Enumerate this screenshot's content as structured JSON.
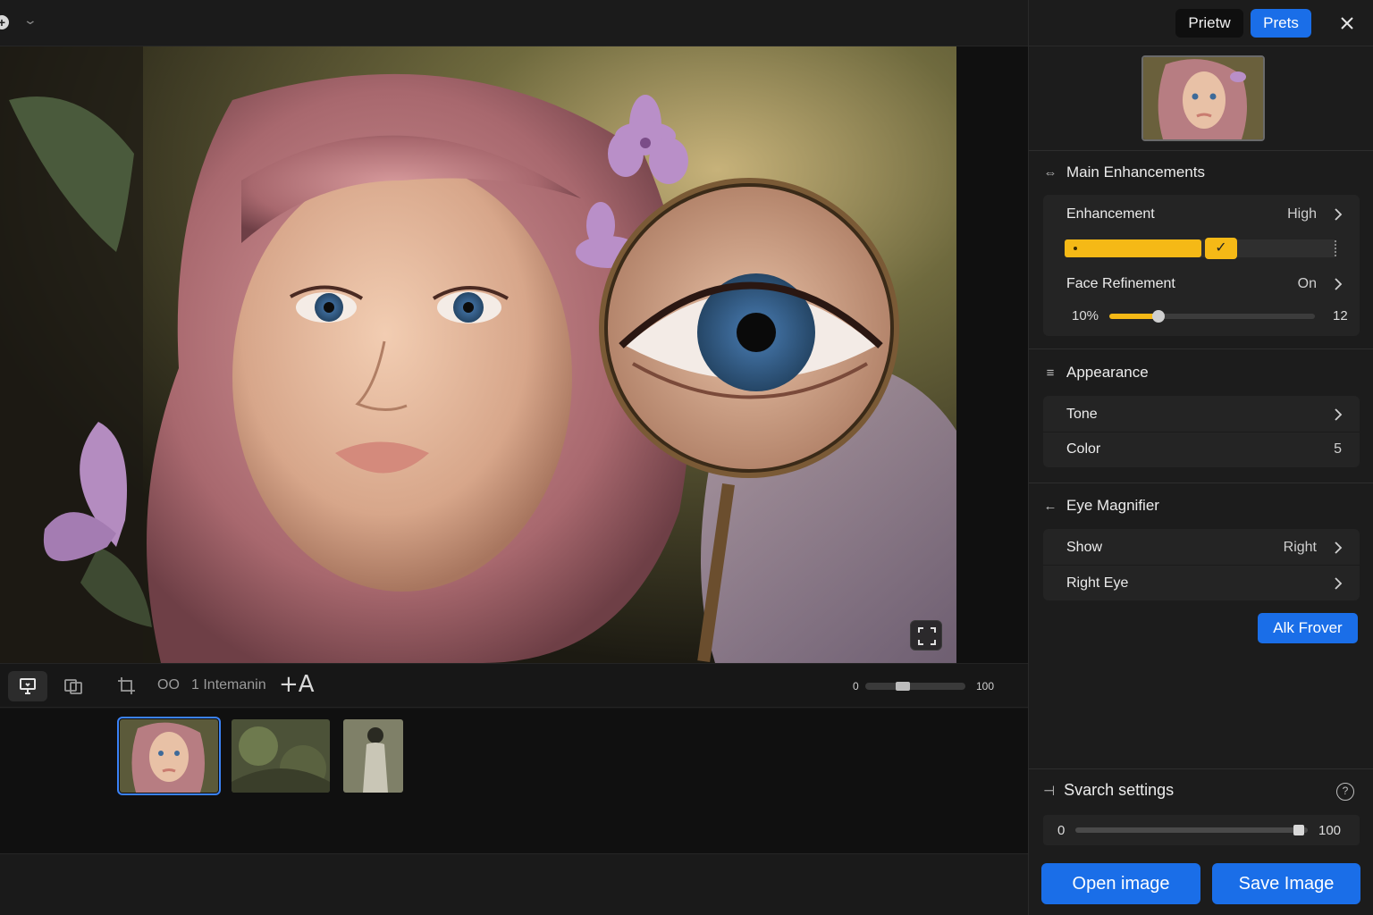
{
  "toolbar": {
    "counter": "OO",
    "label": "1 Intemanin",
    "font_icon": "+A",
    "zoom_min": "0",
    "zoom_max": "100",
    "zoom_value": 30
  },
  "panel": {
    "tabs": {
      "preview": "Prietw",
      "presets": "Prets"
    },
    "main_enhancements": {
      "title": "Main Enhancements",
      "enhancement_label": "Enhancement",
      "enhancement_value": "High",
      "enhancement_level": 0.62,
      "face_refinement_label": "Face Refinement",
      "face_refinement_value": "On",
      "slider_min": "10%",
      "slider_max": "12",
      "slider_level": 0.24
    },
    "appearance": {
      "title": "Appearance",
      "tone_label": "Tone",
      "color_label": "Color",
      "color_value": "5"
    },
    "eye_magnifier": {
      "title": "Eye Magnifier",
      "show_label": "Show",
      "show_value": "Right",
      "right_eye_label": "Right Eye",
      "button": "Alk Frover"
    },
    "search_settings": {
      "title": "Svarch settings",
      "help": "?",
      "min": "0",
      "max": "100",
      "level": 0.97
    },
    "open_button": "Open image",
    "save_button": "Save Image"
  },
  "colors": {
    "accent_blue": "#1a6ee8",
    "accent_yellow": "#f5b916",
    "panel_bg": "#1c1c1c"
  }
}
